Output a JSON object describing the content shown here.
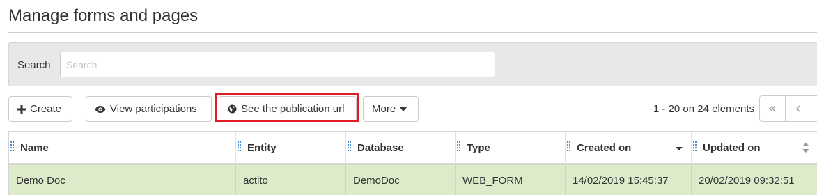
{
  "page": {
    "title": "Manage forms and pages"
  },
  "search": {
    "label": "Search",
    "placeholder": "Search",
    "value": ""
  },
  "toolbar": {
    "create_label": "Create",
    "view_participations_label": "View participations",
    "publication_url_label": "See the publication url",
    "more_label": "More"
  },
  "pagination": {
    "info": "1 - 20 on 24 elements"
  },
  "table": {
    "columns": [
      {
        "label": "Name",
        "sort": "none"
      },
      {
        "label": "Entity",
        "sort": "none"
      },
      {
        "label": "Database",
        "sort": "none"
      },
      {
        "label": "Type",
        "sort": "none"
      },
      {
        "label": "Created on",
        "sort": "desc"
      },
      {
        "label": "Updated on",
        "sort": "both"
      }
    ],
    "rows": [
      [
        "Demo Doc",
        "actito",
        "DemoDoc",
        "WEB_FORM",
        "14/02/2019 15:45:37",
        "20/02/2019 09:32:51"
      ]
    ]
  },
  "colors": {
    "selected_row": "#dcebc9",
    "highlight": "#e01b24",
    "grip": "#4a8fd1"
  }
}
